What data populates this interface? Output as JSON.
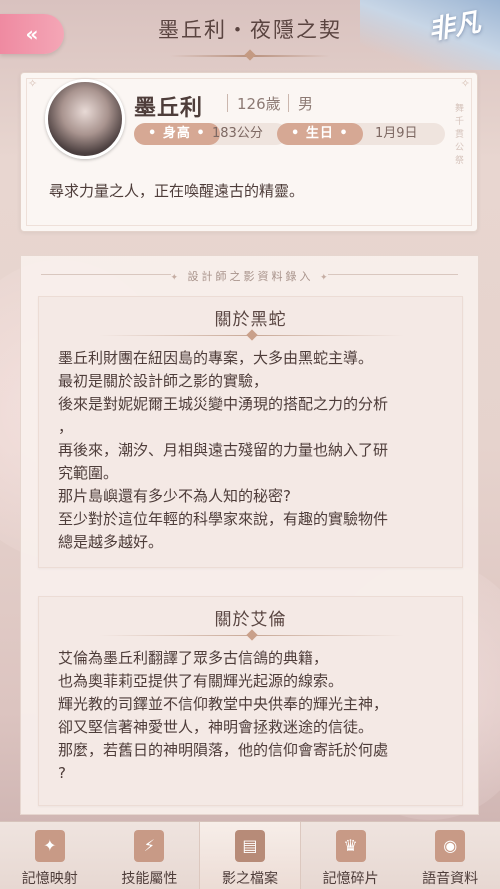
{
  "header": {
    "title": "墨丘利・夜隱之契",
    "back_glyph": "«",
    "rarity": "非凡"
  },
  "profile": {
    "name": "墨丘利",
    "age": "126歲",
    "gender": "男",
    "height_tag": "身高",
    "height_value": "183公分",
    "birthday_tag": "生日",
    "birthday_value": "1月9日",
    "motto": "尋求力量之人，正在喚醒遠古的精靈。",
    "side_text": "舞千貫公祭"
  },
  "panel": {
    "heading": "設計師之影資料錄入",
    "sections": [
      {
        "title": "關於黑蛇",
        "lines": [
          "墨丘利財團在紐因島的專案，大多由黑蛇主導。",
          "最初是關於設計師之影的實驗，",
          "後來是對妮妮爾王城災變中湧現的搭配之力的分析",
          "，",
          "再後來，潮汐、月相與遠古殘留的力量也納入了研",
          "究範圍。",
          "那片島嶼還有多少不為人知的秘密?",
          "至少對於這位年輕的科學家來說，有趣的實驗物件",
          "總是越多越好。"
        ]
      },
      {
        "title": "關於艾倫",
        "lines": [
          "艾倫為墨丘利翻譯了眾多古信鴿的典籍，",
          "也為奧菲莉亞提供了有關輝光起源的線索。",
          "輝光教的司鐸並不信仰教堂中央供奉的輝光主神，",
          "卻又堅信著神愛世人，神明會拯救迷途的信徒。",
          "那麼，若舊日的神明隕落，他的信仰會寄託於何處",
          "?"
        ]
      }
    ]
  },
  "nav": [
    {
      "label": "記憶映射",
      "icon": "card-icon",
      "glyph": "✦",
      "active": false
    },
    {
      "label": "技能屬性",
      "icon": "lightning-icon",
      "glyph": "⚡",
      "active": false
    },
    {
      "label": "影之檔案",
      "icon": "document-icon",
      "glyph": "▤",
      "active": true
    },
    {
      "label": "記憶碎片",
      "icon": "dress-icon",
      "glyph": "♛",
      "active": false
    },
    {
      "label": "語音資料",
      "icon": "voice-icon",
      "glyph": "◉",
      "active": false
    }
  ]
}
